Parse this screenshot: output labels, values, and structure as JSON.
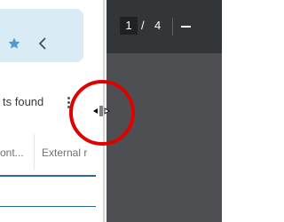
{
  "results": {
    "text": "ts found"
  },
  "columns": [
    {
      "label": "ont..."
    },
    {
      "label": "External r"
    }
  ],
  "pdf_viewer": {
    "current_page": "1",
    "separator": "/",
    "total_pages": "4"
  },
  "colors": {
    "card": "#d9ecf6",
    "accent": "#2a6a92",
    "annotation": "#e00000"
  },
  "icons": [
    "star-icon",
    "chevron-left-icon",
    "more-vert-icon",
    "zoom-out-icon",
    "resize-cursor-icon"
  ]
}
